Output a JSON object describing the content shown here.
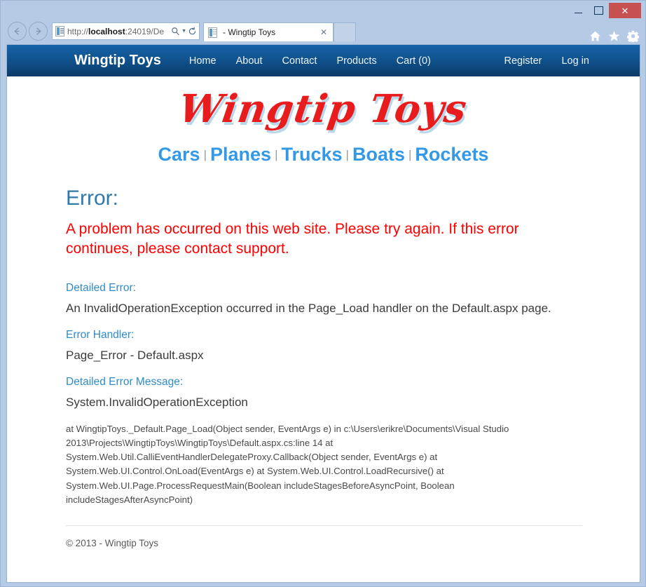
{
  "window": {
    "controls": {
      "minimize": "minimize-button",
      "maximize": "maximize-button",
      "close_label": "✕"
    }
  },
  "browser": {
    "back_glyph": "⇦",
    "forward_glyph": "⇨",
    "address": {
      "scheme": "http://",
      "host": "localhost",
      "rest": ":24019/De"
    },
    "search_glyph": "⌕",
    "caret_glyph": "▼",
    "refresh_glyph": "↻",
    "tab": {
      "title": "- Wingtip Toys",
      "close_label": "✕"
    },
    "icons": {
      "home": "home-icon",
      "favorites": "star-icon",
      "settings": "gear-icon"
    }
  },
  "navbar": {
    "brand": "Wingtip Toys",
    "links": [
      {
        "label": "Home"
      },
      {
        "label": "About"
      },
      {
        "label": "Contact"
      },
      {
        "label": "Products"
      },
      {
        "label": "Cart (0)"
      }
    ],
    "right_links": [
      {
        "label": "Register"
      },
      {
        "label": "Log in"
      }
    ]
  },
  "logo": {
    "text": "Wingtip Toys",
    "color": "#e81c1c",
    "shadow_color": "#b8d8ea"
  },
  "categories": {
    "separator": "|",
    "items": [
      {
        "label": "Cars"
      },
      {
        "label": "Planes"
      },
      {
        "label": "Trucks"
      },
      {
        "label": "Boats"
      },
      {
        "label": "Rockets"
      }
    ],
    "color": "#3399e6"
  },
  "error_page": {
    "heading": "Error:",
    "heading_color": "#2e7aab",
    "message": "A problem has occurred on this web site. Please try again. If this error continues, please contact support.",
    "message_color": "#fe0000",
    "detailed_error_label": "Detailed Error:",
    "detailed_error_value": "An InvalidOperationException occurred in the Page_Load handler on the Default.aspx page.",
    "error_handler_label": "Error Handler:",
    "error_handler_value": "Page_Error - Default.aspx",
    "detailed_message_label": "Detailed Error Message:",
    "detailed_message_value": "System.InvalidOperationException",
    "stack_trace": "at WingtipToys._Default.Page_Load(Object sender, EventArgs e) in c:\\Users\\erikre\\Documents\\Visual Studio 2013\\Projects\\WingtipToys\\WingtipToys\\Default.aspx.cs:line 14 at System.Web.Util.CalliEventHandlerDelegateProxy.Callback(Object sender, EventArgs e) at System.Web.UI.Control.OnLoad(EventArgs e) at System.Web.UI.Control.LoadRecursive() at System.Web.UI.Page.ProcessRequestMain(Boolean includeStagesBeforeAsyncPoint, Boolean includeStagesAfterAsyncPoint)"
  },
  "footer": {
    "copyright": "© 2013 - Wingtip Toys"
  }
}
